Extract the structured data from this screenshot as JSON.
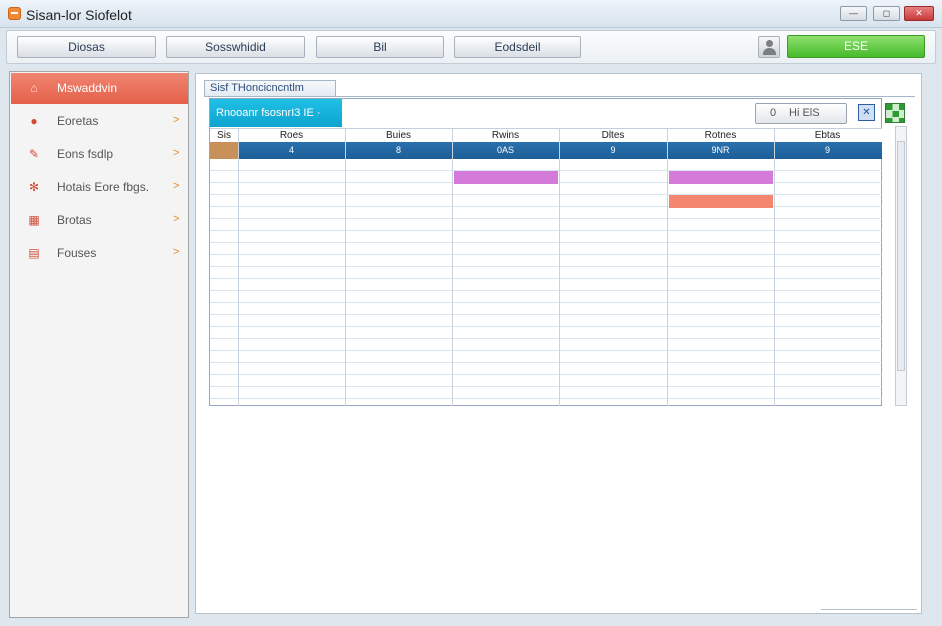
{
  "window": {
    "title": "Sisan-lor Siofelot"
  },
  "toolbar": {
    "b1": "Diosas",
    "b2": "Sosswhidid",
    "b3": "Bil",
    "b4": "Eodsdeil",
    "action": "ESE",
    "user_icon": "user-icon"
  },
  "sidebar": {
    "items": [
      {
        "label": "Mswaddvin",
        "icon": "home-icon",
        "active": true
      },
      {
        "label": "Eoretas",
        "icon": "circle-icon",
        "active": false
      },
      {
        "label": "Eons fsdlp",
        "icon": "pencil-icon",
        "active": false
      },
      {
        "label": "Hotais Eore fbgs.",
        "icon": "gear-icon",
        "active": false
      },
      {
        "label": "Brotas",
        "icon": "grid-icon",
        "active": false
      },
      {
        "label": "Fouses",
        "icon": "document-icon",
        "active": false
      }
    ]
  },
  "main": {
    "tab_label": "Sisf THoncicncntlm",
    "filter_label": "Rnooanr fsosnrI3  IE  ·",
    "pager": {
      "left": "0",
      "right": "Hi ElS"
    },
    "columns": [
      "Sis",
      "Roes",
      "Buies",
      "Rwins",
      "Dltes",
      "Rotnes",
      "Ebtas"
    ],
    "sub_values": [
      "",
      "4",
      "8",
      "0AS",
      "9",
      "9NR",
      "9"
    ]
  },
  "colors": {
    "accent_red": "#e4604a",
    "accent_green": "#45bb2b",
    "accent_cyan": "#0ea4cf",
    "header_blue": "#1d5e98",
    "mark_violet": "#d47ad9",
    "mark_salmon": "#f4856f"
  }
}
